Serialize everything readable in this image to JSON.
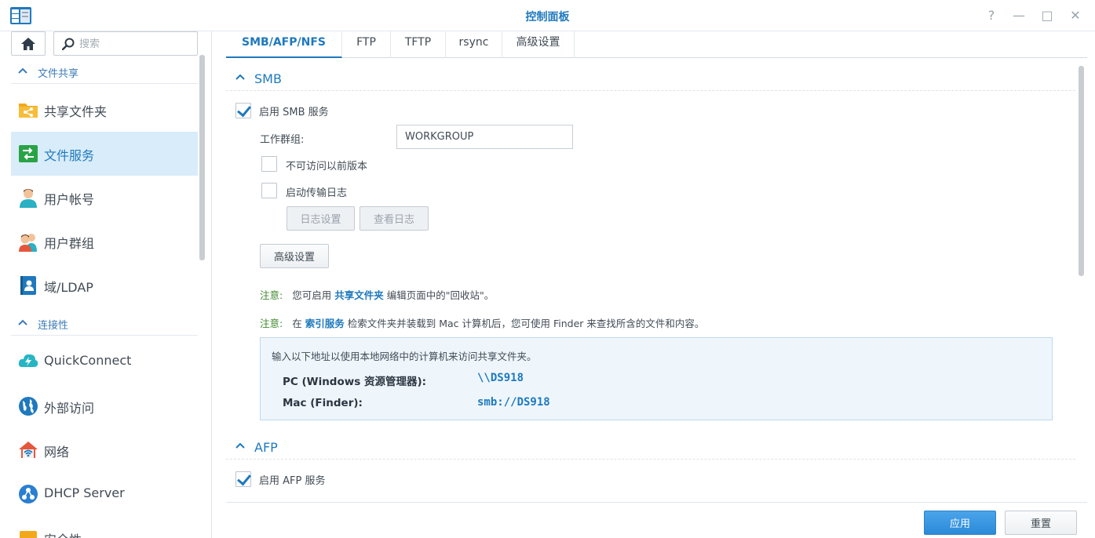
{
  "window": {
    "title": "控制面板",
    "help": "?",
    "minimize": "—",
    "maximize": "□",
    "close": "✕"
  },
  "sidebar": {
    "search_placeholder": "搜索",
    "sections": [
      {
        "label": "文件共享"
      },
      {
        "label": "连接性"
      }
    ],
    "items": [
      {
        "label": "共享文件夹",
        "icon": "shared-folder-icon"
      },
      {
        "label": "文件服务",
        "icon": "file-services-icon",
        "active": true
      },
      {
        "label": "用户帐号",
        "icon": "user-icon"
      },
      {
        "label": "用户群组",
        "icon": "group-icon"
      },
      {
        "label": "域/LDAP",
        "icon": "domain-ldap-icon"
      },
      {
        "label": "QuickConnect",
        "icon": "quickconnect-icon"
      },
      {
        "label": "外部访问",
        "icon": "globe-icon"
      },
      {
        "label": "网络",
        "icon": "network-icon"
      },
      {
        "label": "DHCP Server",
        "icon": "dhcp-icon"
      },
      {
        "label": "安全性",
        "icon": "security-icon"
      }
    ]
  },
  "tabs": [
    {
      "label": "SMB/AFP/NFS",
      "active": true
    },
    {
      "label": "FTP"
    },
    {
      "label": "TFTP"
    },
    {
      "label": "rsync"
    },
    {
      "label": "高级设置"
    }
  ],
  "smb": {
    "header": "SMB",
    "enable_label": "启用 SMB 服务",
    "enable_checked": true,
    "workgroup_label": "工作群组:",
    "workgroup_value": "WORKGROUP",
    "no_prev_versions_label": "不可访问以前版本",
    "transfer_log_label": "启动传输日志",
    "log_settings_button": "日志设置",
    "view_log_button": "查看日志",
    "advanced_button": "高级设置",
    "note1": {
      "prefix": "注意:",
      "before": "您可启用",
      "link": "共享文件夹",
      "after": "编辑页面中的\"回收站\"。"
    },
    "note2": {
      "prefix": "注意:",
      "before": "在",
      "link": "索引服务",
      "after": "检索文件夹并装载到 Mac 计算机后，您可使用 Finder 来查找所含的文件和内容。"
    },
    "info": {
      "intro": "输入以下地址以使用本地网络中的计算机来访问共享文件夹。",
      "pc_label": "PC (Windows 资源管理器):",
      "pc_value": "\\\\DS918",
      "mac_label": "Mac (Finder):",
      "mac_value": "smb://DS918"
    }
  },
  "afp": {
    "header": "AFP",
    "enable_label": "启用 AFP 服务",
    "enable_checked": true
  },
  "footer": {
    "apply": "应用",
    "reset": "重置"
  },
  "colors": {
    "accent": "#1f79bd",
    "note_label": "#3f8a2f",
    "active_bg": "#d8ecfa"
  }
}
